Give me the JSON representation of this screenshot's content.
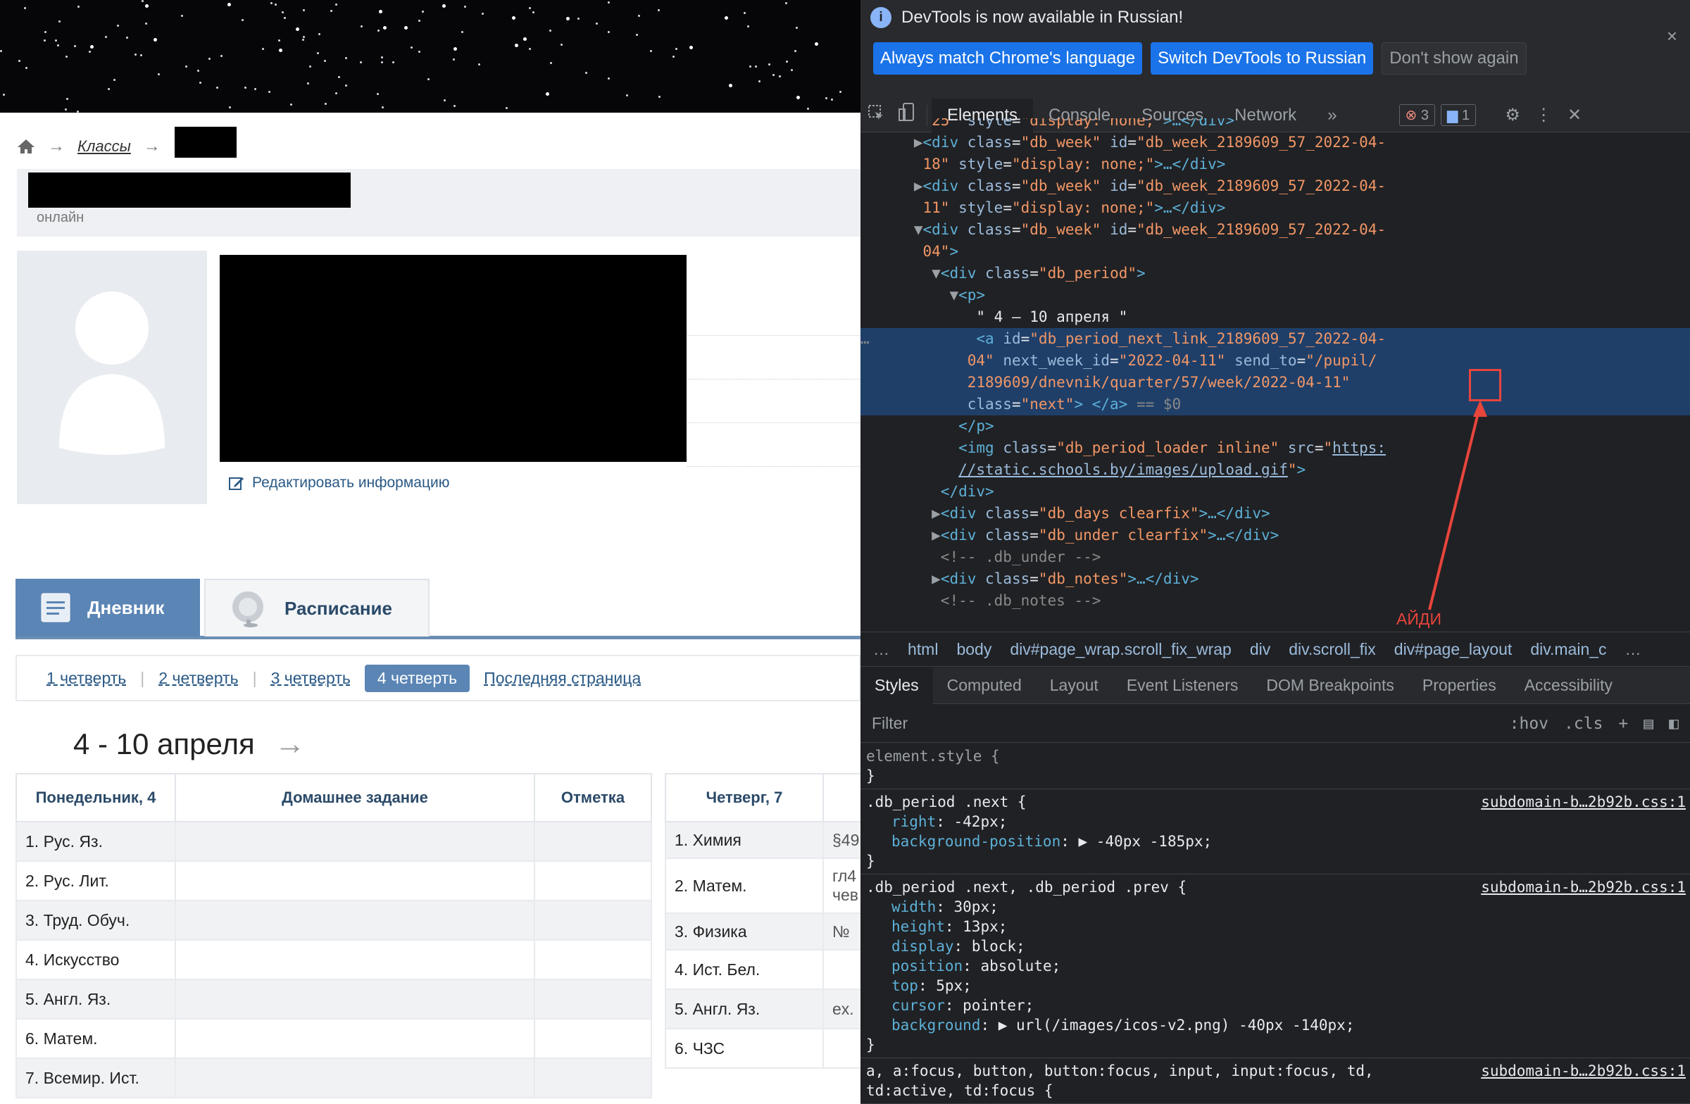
{
  "site": {
    "breadcrumb": {
      "home_icon": "home-icon",
      "arrow": "→",
      "classes_link": "Классы"
    },
    "online_status": "онлайн",
    "edit_info": "Редактировать информацию",
    "tabs": [
      {
        "label": "Дневник",
        "icon": "diary-icon"
      },
      {
        "label": "Расписание",
        "icon": "bell-icon"
      }
    ],
    "quarters": [
      "1 четверть",
      "2 четверть",
      "3 четверть",
      "4 четверть",
      "Последняя страница"
    ],
    "quarter_sep": "|",
    "week_title": "4 - 10 апреля",
    "next_arrow": "→",
    "table1": {
      "headers": [
        "Понедельник, 4",
        "Домашнее задание",
        "Отметка"
      ],
      "rows": [
        "1. Рус. Яз.",
        "2. Рус. Лит.",
        "3. Труд. Обуч.",
        "4. Искусство",
        "5. Англ. Яз.",
        "6. Матем.",
        "7. Всемир. Ист."
      ]
    },
    "table2": {
      "header": "Четверг, 7",
      "rows": [
        {
          "subject": "1. Химия",
          "hw": "§49"
        },
        {
          "subject": "2. Матем.",
          "hw": "гл4\nчев"
        },
        {
          "subject": "3. Физика",
          "hw": "№"
        },
        {
          "subject": "4. Ист. Бел.",
          "hw": ""
        },
        {
          "subject": "5. Англ. Яз.",
          "hw": "ex."
        },
        {
          "subject": "6. ЧЗС",
          "hw": ""
        }
      ]
    }
  },
  "devtools": {
    "infobar": {
      "message": "DevTools is now available in Russian!",
      "buttons": [
        "Always match Chrome's language",
        "Switch DevTools to Russian",
        "Don't show again"
      ],
      "close": "×"
    },
    "tabs": [
      "Elements",
      "Console",
      "Sources",
      "Network"
    ],
    "more": "»",
    "errors": "3",
    "messages": "1",
    "code_lines": [
      {
        "i": 0,
        "html": "        <span class='val'>25\"</span> <span class='attr'>style</span>=<span class='val'>\"display: none;\"</span><span class='tag'>&gt;…&lt;/div&gt;</span>"
      },
      {
        "i": 0,
        "html": "      <span class='tri'>▶</span><span class='tag'>&lt;div</span> <span class='attr'>class</span>=<span class='val'>\"db_week\"</span> <span class='attr'>id</span>=<span class='val'>\"db_week_2189609_57_2022-04-</span>"
      },
      {
        "i": 0,
        "html": "       <span class='val'>18\"</span> <span class='attr'>style</span>=<span class='val'>\"display: none;\"</span><span class='tag'>&gt;…&lt;/div&gt;</span>"
      },
      {
        "i": 0,
        "html": "      <span class='tri'>▶</span><span class='tag'>&lt;div</span> <span class='attr'>class</span>=<span class='val'>\"db_week\"</span> <span class='attr'>id</span>=<span class='val'>\"db_week_2189609_57_2022-04-</span>"
      },
      {
        "i": 0,
        "html": "       <span class='val'>11\"</span> <span class='attr'>style</span>=<span class='val'>\"display: none;\"</span><span class='tag'>&gt;…&lt;/div&gt;</span>"
      },
      {
        "i": 0,
        "html": "      <span class='tri'>▼</span><span class='tag'>&lt;div</span> <span class='attr'>class</span>=<span class='val'>\"db_week\"</span> <span class='attr'>id</span>=<span class='val'>\"db_week_2189609_57_2022-04-</span>"
      },
      {
        "i": 0,
        "html": "       <span class='val'>04\"</span><span class='tag'>&gt;</span>"
      },
      {
        "i": 0,
        "html": "        <span class='tri'>▼</span><span class='tag'>&lt;div</span> <span class='attr'>class</span>=<span class='val'>\"db_period\"</span><span class='tag'>&gt;</span>"
      },
      {
        "i": 0,
        "html": "          <span class='tri'>▼</span><span class='tag'>&lt;p&gt;</span>"
      },
      {
        "i": 0,
        "html": "             <span class='txt'>\" 4 – 10 апреля \"</span>"
      },
      {
        "i": 1,
        "html": "<span class='cmt'>…</span>            <span class='tag'>&lt;a</span> <span class='attr'>id</span>=<span class='val'>\"db_period_next_link_2189609_57_2022-04-</span>"
      },
      {
        "i": 1,
        "html": "            <span class='val'>04\"</span> <span class='attr'>next_week_id</span>=<span class='val'>\"2022-04-11\"</span> <span class='attr'>send_to</span>=<span class='val'>\"/pupil/</span>"
      },
      {
        "i": 1,
        "html": "            <span class='val'>2189609/dnevnik/quarter/57/week/2022-04-11\"</span>"
      },
      {
        "i": 1,
        "html": "            <span class='attr'>class</span>=<span class='val'>\"next\"</span><span class='tag'>&gt; &lt;/a&gt;</span> <span class='cmt'>== $0</span>"
      },
      {
        "i": 0,
        "html": "           <span class='tag'>&lt;/p&gt;</span>"
      },
      {
        "i": 0,
        "html": "           <span class='tag'>&lt;img</span> <span class='attr'>class</span>=<span class='val'>\"db_period_loader inline\"</span> <span class='attr'>src</span>=<span class='val'>\"</span><span class='link'>https:</span>"
      },
      {
        "i": 0,
        "html": "           <span class='link'>//static.schools.by/images/upload.gif</span><span class='val'>\"</span><span class='tag'>&gt;</span>"
      },
      {
        "i": 0,
        "html": "         <span class='tag'>&lt;/div&gt;</span>"
      },
      {
        "i": 0,
        "html": "        <span class='tri'>▶</span><span class='tag'>&lt;div</span> <span class='attr'>class</span>=<span class='val'>\"db_days clearfix\"</span><span class='tag'>&gt;…&lt;/div&gt;</span>"
      },
      {
        "i": 0,
        "html": "        <span class='tri'>▶</span><span class='tag'>&lt;div</span> <span class='attr'>class</span>=<span class='val'>\"db_under clearfix\"</span><span class='tag'>&gt;…&lt;/div&gt;</span>"
      },
      {
        "i": 0,
        "html": "         <span class='cmt'>&lt;!-- .db_under --&gt;</span>"
      },
      {
        "i": 0,
        "html": "        <span class='tri'>▶</span><span class='tag'>&lt;div</span> <span class='attr'>class</span>=<span class='val'>\"db_notes\"</span><span class='tag'>&gt;…&lt;/div&gt;</span>"
      },
      {
        "i": 0,
        "html": "         <span class='cmt'>&lt;!-- .db_notes --&gt;</span>"
      }
    ],
    "annotation": "АЙДИ",
    "breadcrumbs": [
      "…",
      "html",
      "body",
      "div#page_wrap.scroll_fix_wrap",
      "div",
      "div.scroll_fix",
      "div#page_layout",
      "div.main_c",
      "…"
    ],
    "style_tabs": [
      "Styles",
      "Computed",
      "Layout",
      "Event Listeners",
      "DOM Breakpoints",
      "Properties",
      "Accessibility"
    ],
    "filter_placeholder": "Filter",
    "filter_tools": [
      ":hov",
      ".cls",
      "+"
    ],
    "rules": [
      {
        "selector": "element.style {",
        "source": "",
        "props": [],
        "close": "}"
      },
      {
        "selector": ".db_period .next {",
        "source": "subdomain-b…2b92b.css:1",
        "props": [
          [
            "right",
            "-42px;"
          ],
          [
            "background-position",
            "▶ -40px -185px;"
          ]
        ],
        "close": "}"
      },
      {
        "selector": ".db_period .next, .db_period .prev {",
        "source": "subdomain-b…2b92b.css:1",
        "props": [
          [
            "width",
            "30px;"
          ],
          [
            "height",
            "13px;"
          ],
          [
            "display",
            "block;"
          ],
          [
            "position",
            "absolute;"
          ],
          [
            "top",
            "5px;"
          ],
          [
            "cursor",
            "pointer;"
          ],
          [
            "background",
            "▶ url(/images/icos-v2.png) -40px -140px;"
          ]
        ],
        "close": "}"
      },
      {
        "selector": "a, a:focus, button, button:focus, input, input:focus, td,",
        "source": "subdomain-b…2b92b.css:1",
        "props": [],
        "close": "td:active, td:focus {"
      }
    ]
  }
}
